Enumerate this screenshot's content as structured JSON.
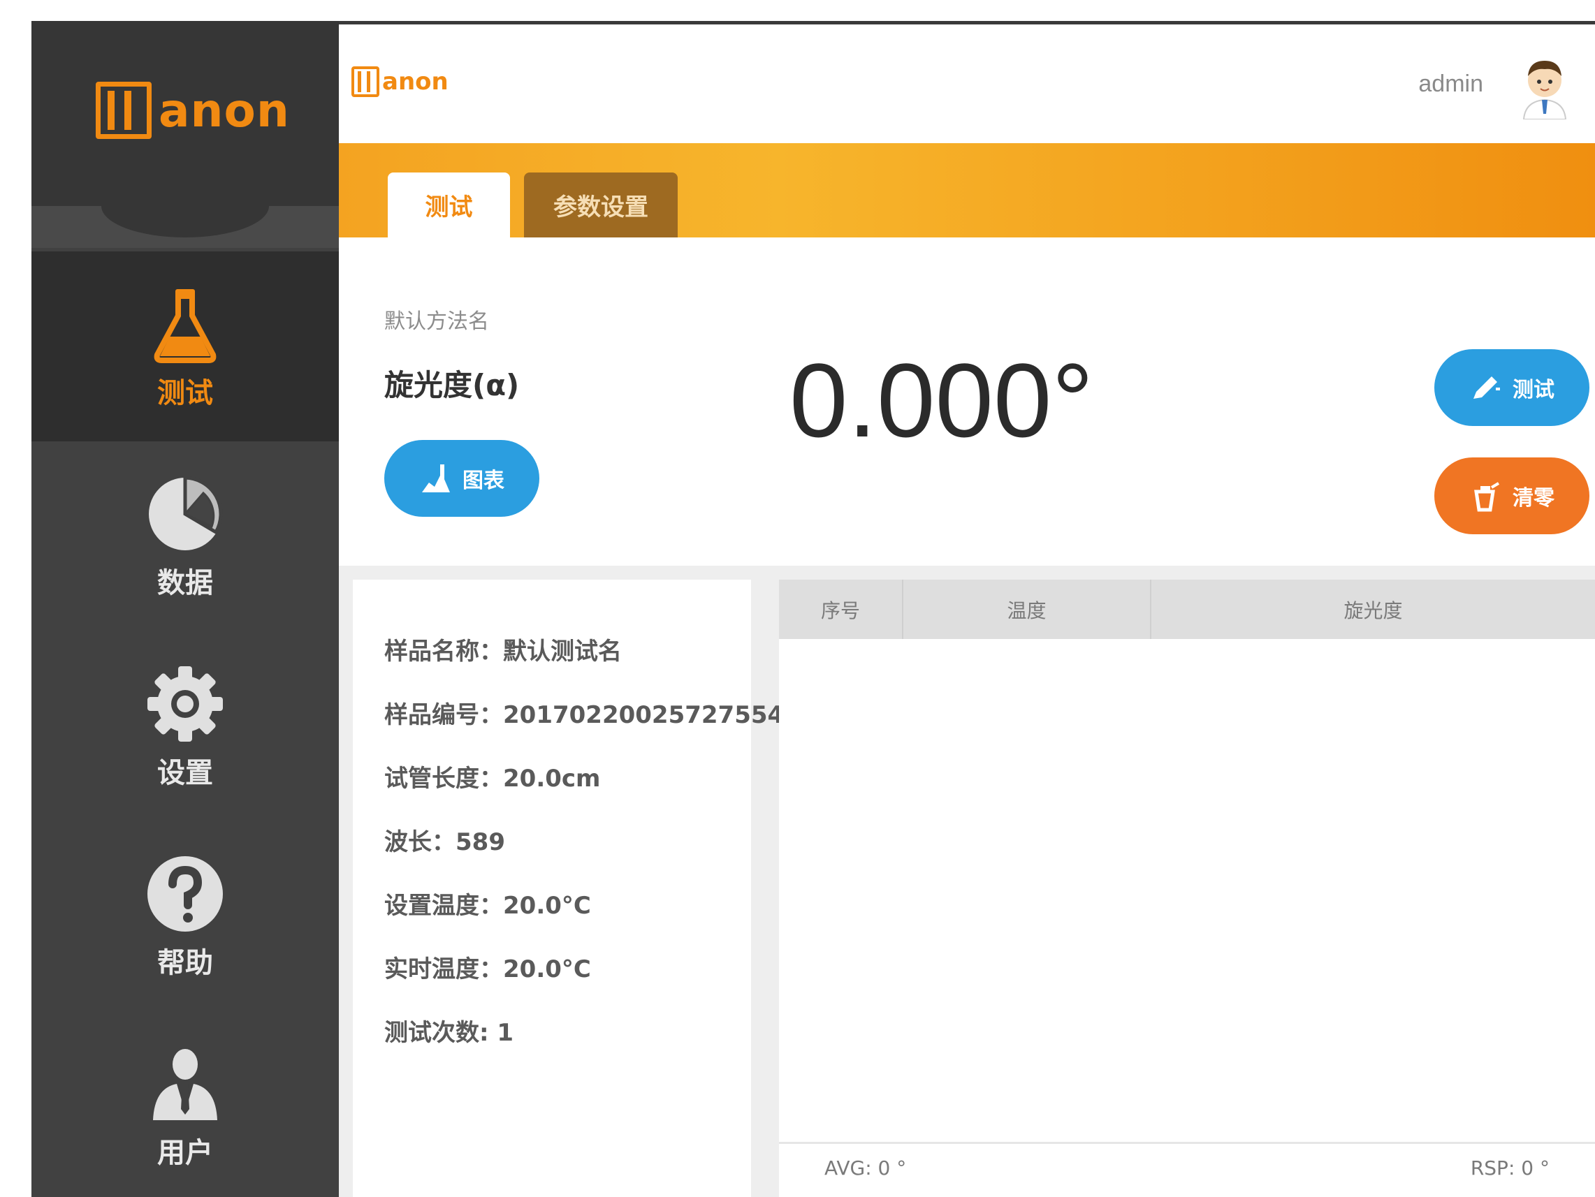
{
  "brand": {
    "logo_text": "anon",
    "accent_color": "#f18a12"
  },
  "sidebar": {
    "items": [
      {
        "label": "测试",
        "icon": "flask-icon",
        "active": true
      },
      {
        "label": "数据",
        "icon": "pie-chart-icon",
        "active": false
      },
      {
        "label": "设置",
        "icon": "gear-icon",
        "active": false
      },
      {
        "label": "帮助",
        "icon": "help-icon",
        "active": false
      },
      {
        "label": "用户",
        "icon": "user-icon",
        "active": false
      }
    ]
  },
  "header": {
    "username": "admin",
    "avatar_icon": "avatar-icon"
  },
  "tabs": [
    {
      "label": "测试",
      "active": true
    },
    {
      "label": "参数设置",
      "active": false
    }
  ],
  "method": {
    "caption": "默认方法名",
    "name": "旋光度(α)"
  },
  "reading": {
    "value": "0.000°"
  },
  "buttons": {
    "chart": {
      "label": "图表",
      "icon": "chart-icon",
      "color": "#2b9ee0"
    },
    "test": {
      "label": "测试",
      "icon": "pen-icon",
      "color": "#2b9ee0"
    },
    "clear": {
      "label": "清零",
      "icon": "clear-icon",
      "color": "#f07523"
    }
  },
  "sample_info": {
    "name": "样品名称：默认测试名",
    "number": "样品编号：20170220025727554",
    "tube_length": "试管长度：20.0cm",
    "wavelength": "波长：589",
    "set_temperature": "设置温度：20.0°C",
    "realtime_temperature": "实时温度：20.0°C",
    "test_count": "测试次数: 1"
  },
  "results_table": {
    "columns": [
      "序号",
      "温度",
      "旋光度"
    ],
    "rows": [],
    "avg": "AVG: 0 °",
    "rsp": "RSP: 0 °"
  }
}
